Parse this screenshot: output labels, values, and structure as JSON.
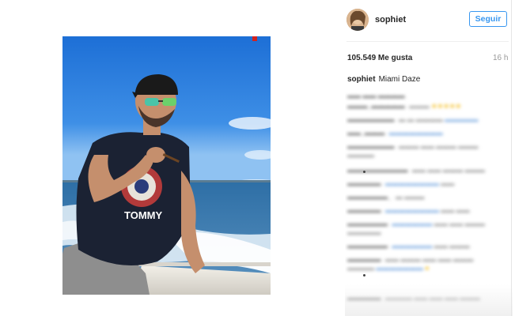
{
  "post": {
    "username": "sophiet",
    "follow_label": "Seguir",
    "likes": "105.549 Me gusta",
    "time_ago": "16 h",
    "caption_user": "sophiet",
    "caption_text": "Miami Daze"
  },
  "photo": {
    "shirt_text": "TOMMY"
  },
  "colors": {
    "accent": "#3897f0",
    "text": "#262626",
    "muted": "#999999"
  },
  "icons": {
    "avatar": "profile-photo"
  }
}
